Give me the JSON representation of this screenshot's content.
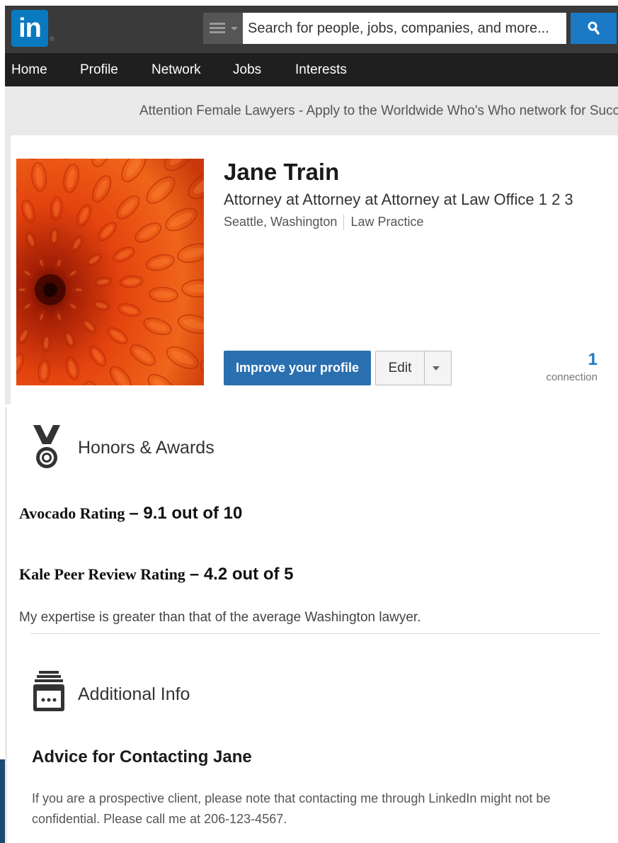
{
  "topbar": {
    "logo_text": "in",
    "registered_mark": "®",
    "search": {
      "placeholder": "Search for people, jobs, companies, and more...",
      "icon": "search-icon"
    },
    "colors": {
      "bar": "#3a3a3a",
      "logo": "#0a7ac0",
      "search_button": "#1b7ac6"
    }
  },
  "nav": {
    "items": [
      {
        "label": "Home"
      },
      {
        "label": "Profile"
      },
      {
        "label": "Network"
      },
      {
        "label": "Jobs"
      },
      {
        "label": "Interests"
      }
    ]
  },
  "banner": {
    "text": "Attention Female Lawyers - Apply to the Worldwide Who's Who network for Succe"
  },
  "profile": {
    "name": "Jane Train",
    "headline": "Attorney at Attorney at Attorney at Law Office 1 2 3",
    "location": "Seattle, Washington",
    "industry": "Law Practice",
    "improve_button": "Improve your profile",
    "edit_button": "Edit",
    "connections_count": "1",
    "connections_label": "connection",
    "accent_color": "#2a6fb0"
  },
  "honors": {
    "icon": "medal-icon",
    "title": "Honors & Awards",
    "ratings": [
      {
        "label": "Avocado Rating",
        "value": "– 9.1 out of 10"
      },
      {
        "label": "Kale Peer Review Rating",
        "value": "– 4.2 out of 5"
      }
    ],
    "note": "My expertise is greater than that of the average Washington lawyer."
  },
  "additional": {
    "icon": "file-cabinet-icon",
    "title": "Additional Info",
    "advice_title": "Advice for Contacting Jane",
    "advice_text": "If you are a prospective client, please note that contacting me through LinkedIn might not be confidential. Please call me at 206-123-4567."
  }
}
